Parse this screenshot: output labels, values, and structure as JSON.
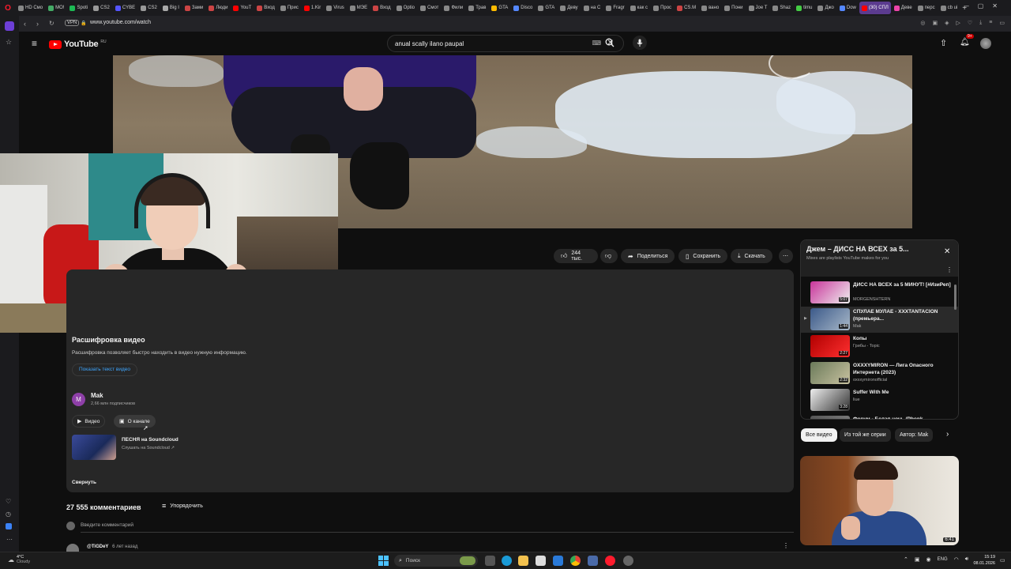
{
  "browser": {
    "tabs": [
      {
        "label": "HD Смо",
        "color": "#888"
      },
      {
        "label": "МО!",
        "color": "#4a6"
      },
      {
        "label": "Spoti",
        "color": "#1db954"
      },
      {
        "label": "CS2",
        "color": "#999"
      },
      {
        "label": "CYBE",
        "color": "#55f"
      },
      {
        "label": "CS2",
        "color": "#999"
      },
      {
        "label": "Big I",
        "color": "#aaa"
      },
      {
        "label": "Зами",
        "color": "#c44"
      },
      {
        "label": "Люди",
        "color": "#c44"
      },
      {
        "label": "YouT",
        "color": "#f00"
      },
      {
        "label": "Вход",
        "color": "#c44"
      },
      {
        "label": "Прис",
        "color": "#888"
      },
      {
        "label": "1.Kir",
        "color": "#f00"
      },
      {
        "label": "Virus",
        "color": "#888"
      },
      {
        "label": "МЭЕ",
        "color": "#888"
      },
      {
        "label": "Вход",
        "color": "#c44"
      },
      {
        "label": "Optio",
        "color": "#888"
      },
      {
        "label": "Смот",
        "color": "#888"
      },
      {
        "label": "Фили",
        "color": "#888"
      },
      {
        "label": "Трав",
        "color": "#888"
      },
      {
        "label": "GTA",
        "color": "#fb0"
      },
      {
        "label": "Disco",
        "color": "#58f"
      },
      {
        "label": "GTA",
        "color": "#888"
      },
      {
        "label": "Деву",
        "color": "#888"
      },
      {
        "label": "на С",
        "color": "#888"
      },
      {
        "label": "Fragr",
        "color": "#888"
      },
      {
        "label": "как с",
        "color": "#888"
      },
      {
        "label": "Прос",
        "color": "#888"
      },
      {
        "label": "CS.M",
        "color": "#c44"
      },
      {
        "label": "вано",
        "color": "#888"
      },
      {
        "label": "Пони",
        "color": "#888"
      },
      {
        "label": "Joe T",
        "color": "#888"
      },
      {
        "label": "Shaz",
        "color": "#888"
      },
      {
        "label": "timu",
        "color": "#4c4"
      },
      {
        "label": "Джо",
        "color": "#888"
      },
      {
        "label": "Dow",
        "color": "#58f"
      },
      {
        "label": "(30) СПЛ",
        "color": "#f00",
        "active": true
      },
      {
        "label": "Деве",
        "color": "#e4a"
      },
      {
        "label": "перс",
        "color": "#888"
      },
      {
        "label": "cb ui",
        "color": "#888"
      }
    ],
    "vpn": "VPN",
    "url": "www.youtube.com/watch"
  },
  "youtube": {
    "logo_text": "YouTube",
    "country": "RU",
    "search_query": "anual scally ilano paupal",
    "notif_count": "9+"
  },
  "actions": {
    "likes": "244 тыс.",
    "share": "Поделиться",
    "save": "Сохранить",
    "download": "Скачать"
  },
  "description": {
    "transcript_title": "Расшифровка видео",
    "transcript_text": "Расшифровка позволяет быстро находить в видео нужную информацию.",
    "transcript_button": "Показать текст видео",
    "channel_initial": "M",
    "channel_name": "Mak",
    "channel_subs": "2,66 млн подписчиков",
    "btn_videos": "Видео",
    "btn_about": "О канале",
    "song_title": "ПЕСНЯ на Soundcloud",
    "song_sub": "Слушать на Soundcloud ↗",
    "collapse": "Свернуть"
  },
  "comments": {
    "count": "27 555 комментариев",
    "sort": "Упорядочить",
    "placeholder": "Введите комментарий",
    "first_author": "@TiGDeY",
    "first_time": "6 лет назад"
  },
  "playlist": {
    "title": "Джем – ДИСС НА ВСЕХ за 5...",
    "subtitle": "Mixes are playlists YouTube makes for you",
    "items": [
      {
        "title": "ДИСС НА ВСЕХ за 5 МИНУТ! [#ИзиРеп]",
        "channel": "MORGENSHTERN",
        "duration": "5:07",
        "c1": "#c8349a",
        "c2": "#f0f0f0"
      },
      {
        "title": "СПУЛАЕ МУЛАЕ - XXXTANTACION (премьера...",
        "channel": "Mak",
        "duration": "1:44",
        "c1": "#3c5a8a",
        "c2": "#a8b8c8",
        "current": true
      },
      {
        "title": "Копы",
        "channel": "Грибы - Topic",
        "duration": "2:27",
        "c1": "#b10000",
        "c2": "#ff3030"
      },
      {
        "title": "OXXXYMIRON — Лига Опасного Интернета (2023)",
        "channel": "oxxxymironofficial",
        "duration": "2:32",
        "c1": "#6a7a5a",
        "c2": "#c9c2a0"
      },
      {
        "title": "Suffer With Me",
        "channel": "liue",
        "duration": "3:28",
        "c1": "#eeeeee",
        "c2": "#333333"
      },
      {
        "title": "Форум - Белая ночь (Phonk",
        "channel": "",
        "duration": "",
        "c1": "#555",
        "c2": "#888"
      }
    ]
  },
  "chips": [
    "Все видео",
    "Из той же серии",
    "Автор: Mak"
  ],
  "related": {
    "duration": "6:41"
  },
  "taskbar": {
    "weather_temp": "4°C",
    "weather_text": "Cloudy",
    "search": "Поиск",
    "lang": "ENG",
    "time": "15:19",
    "date": "08.01.2026"
  }
}
